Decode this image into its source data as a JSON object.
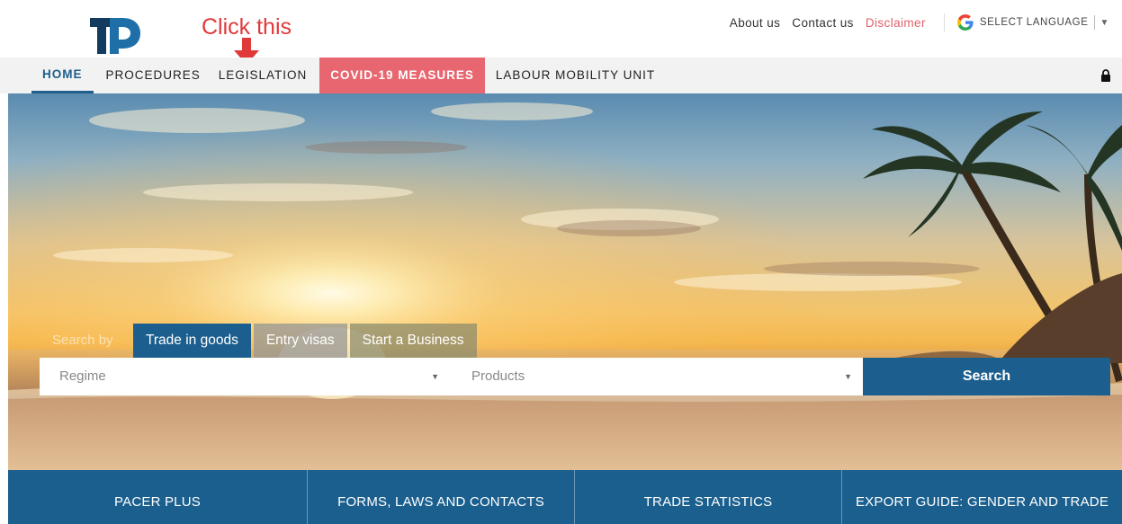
{
  "annotation": {
    "text": "Click this"
  },
  "top_links": {
    "about": "About us",
    "contact": "Contact us",
    "disclaimer": "Disclaimer",
    "language": "SELECT LANGUAGE"
  },
  "nav": {
    "items": [
      {
        "label": "HOME"
      },
      {
        "label": "PROCEDURES"
      },
      {
        "label": "LEGISLATION"
      },
      {
        "label": "COVID-19 MEASURES"
      },
      {
        "label": "LABOUR MOBILITY UNIT"
      }
    ]
  },
  "search": {
    "search_by": "Search by",
    "tabs": [
      {
        "label": "Trade in goods"
      },
      {
        "label": "Entry visas"
      },
      {
        "label": "Start a Business"
      }
    ],
    "regime_placeholder": "Regime",
    "products_placeholder": "Products",
    "button": "Search"
  },
  "bottom_bar": {
    "items": [
      {
        "label": "PACER PLUS"
      },
      {
        "label": "FORMS, LAWS AND CONTACTS"
      },
      {
        "label": "TRADE STATISTICS"
      },
      {
        "label": "EXPORT GUIDE: GENDER AND TRADE"
      }
    ]
  },
  "colors": {
    "brand_blue": "#1c5f8f",
    "covid_red": "#e8666f",
    "annotation_red": "#e0393a",
    "disclaimer_pink": "#e0616b"
  },
  "icons": {
    "logo": "tp-logo",
    "google": "google-g-icon",
    "lock": "lock-icon",
    "arrow": "down-arrow-icon"
  }
}
